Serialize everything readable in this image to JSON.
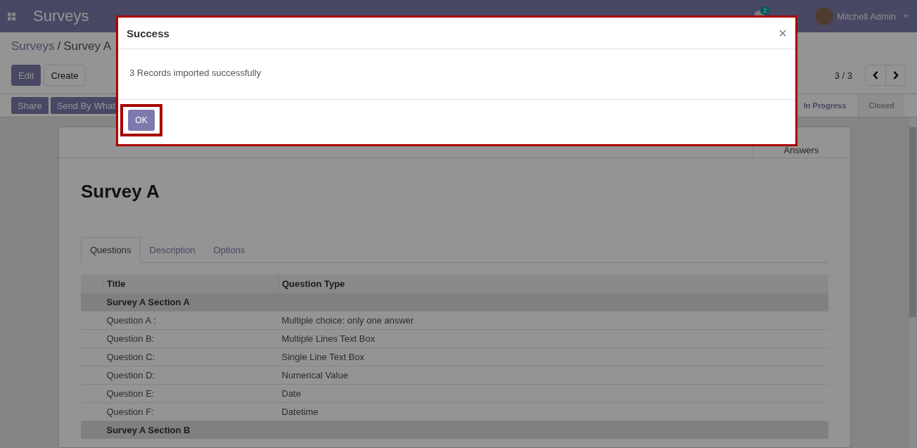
{
  "navbar": {
    "app_name": "Surveys",
    "notification_count": "2",
    "user_name": "Mitchell Admin"
  },
  "breadcrumb_separator": "/",
  "breadcrumb": [
    {
      "label": "Surveys",
      "kind": "link"
    },
    {
      "label": "Survey A",
      "kind": "current"
    }
  ],
  "buttons": [
    {
      "label": "Edit",
      "kind": "primary"
    },
    {
      "label": "Create",
      "kind": "secondary"
    }
  ],
  "pager": {
    "counter": "3 / 3"
  },
  "actions": [
    {
      "label": "Share"
    },
    {
      "label": "Send By What"
    }
  ],
  "stages": [
    {
      "label": "In Progress",
      "selected": true
    },
    {
      "label": "Closed",
      "selected": false
    }
  ],
  "sheet": {
    "stat_button": "Answers",
    "title": "Survey A",
    "tabs": [
      {
        "label": "Questions",
        "selected": true
      },
      {
        "label": "Description",
        "selected": false
      },
      {
        "label": "Options",
        "selected": false
      }
    ],
    "table": {
      "columns": [
        "Title",
        "Question Type"
      ],
      "rows": [
        {
          "kind": "section",
          "title": "Survey A Section A"
        },
        {
          "kind": "question",
          "title": "Question A :",
          "type": "Multiple choice: only one answer"
        },
        {
          "kind": "question",
          "title": "Question B:",
          "type": "Multiple Lines Text Box"
        },
        {
          "kind": "question",
          "title": "Question C:",
          "type": "Single Line Text Box"
        },
        {
          "kind": "question",
          "title": "Question D:",
          "type": "Numerical Value"
        },
        {
          "kind": "question",
          "title": "Question E:",
          "type": "Date"
        },
        {
          "kind": "question",
          "title": "Question F:",
          "type": "Datetime"
        },
        {
          "kind": "section",
          "title": "Survey A Section B"
        }
      ]
    }
  },
  "dialog": {
    "title": "Success",
    "close": "×",
    "message": "3 Records imported successfully",
    "button": "OK"
  }
}
